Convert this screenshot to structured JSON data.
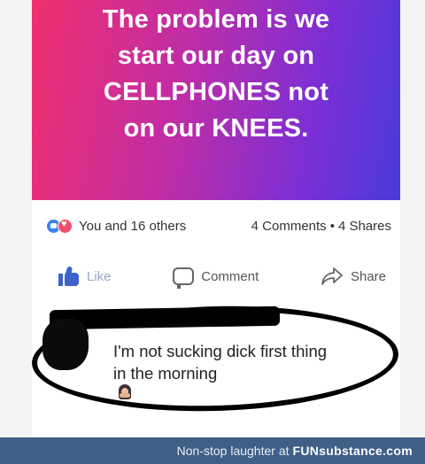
{
  "banner": {
    "lines": [
      "The problem is we",
      "start our day on",
      "CELLPHONES not",
      "on our KNEES."
    ]
  },
  "reactions": {
    "count_text": "You and 16 others",
    "comments": "4 Comments",
    "separator": "•",
    "shares": "4 Shares"
  },
  "actions": {
    "like": "Like",
    "comment": "Comment",
    "share": "Share"
  },
  "comment": {
    "lines": [
      "I'm not sucking dick first thing",
      "in the morning"
    ],
    "emoji": "person-facepalming-emoji"
  },
  "footer": {
    "caption": "Non-stop laughter at",
    "brand": "FUNsubstance.com"
  },
  "colors": {
    "banner_gradient": [
      "#f02f6e",
      "#c12da5",
      "#7b2fd6",
      "#4a3ad9"
    ],
    "like_blue": "#3b63c9",
    "footer_bg": "#3f5f86"
  }
}
